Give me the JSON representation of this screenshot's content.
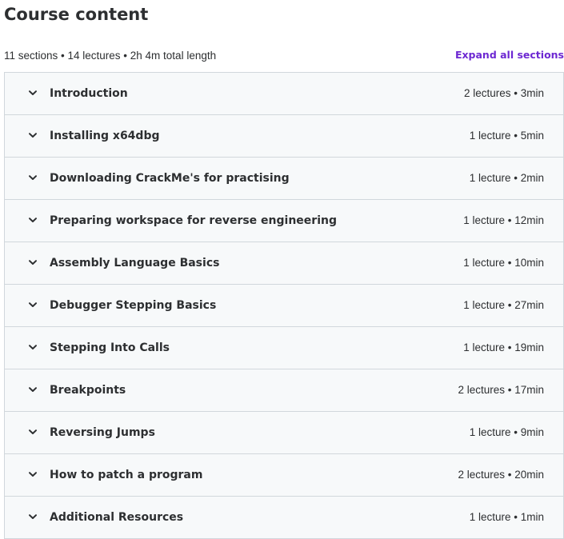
{
  "header": {
    "title": "Course content",
    "summary": "11 sections • 14 lectures • 2h 4m total length",
    "expand_all_label": "Expand all sections"
  },
  "colors": {
    "text": "#2d2f31",
    "accent": "#6d28d2",
    "border": "#d1d7dc",
    "section_bg": "#f7f9fa"
  },
  "sections": [
    {
      "title": "Introduction",
      "meta": "2 lectures • 3min",
      "icon": "chevron-down-icon"
    },
    {
      "title": "Installing x64dbg",
      "meta": "1 lecture • 5min",
      "icon": "chevron-down-icon"
    },
    {
      "title": "Downloading CrackMe's for practising",
      "meta": "1 lecture • 2min",
      "icon": "chevron-down-icon"
    },
    {
      "title": "Preparing workspace for reverse engineering",
      "meta": "1 lecture • 12min",
      "icon": "chevron-down-icon"
    },
    {
      "title": "Assembly Language Basics",
      "meta": "1 lecture • 10min",
      "icon": "chevron-down-icon"
    },
    {
      "title": "Debugger Stepping Basics",
      "meta": "1 lecture • 27min",
      "icon": "chevron-down-icon"
    },
    {
      "title": "Stepping Into Calls",
      "meta": "1 lecture • 19min",
      "icon": "chevron-down-icon"
    },
    {
      "title": "Breakpoints",
      "meta": "2 lectures • 17min",
      "icon": "chevron-down-icon"
    },
    {
      "title": "Reversing Jumps",
      "meta": "1 lecture • 9min",
      "icon": "chevron-down-icon"
    },
    {
      "title": "How to patch a program",
      "meta": "2 lectures • 20min",
      "icon": "chevron-down-icon"
    },
    {
      "title": "Additional Resources",
      "meta": "1 lecture • 1min",
      "icon": "chevron-down-icon"
    }
  ]
}
